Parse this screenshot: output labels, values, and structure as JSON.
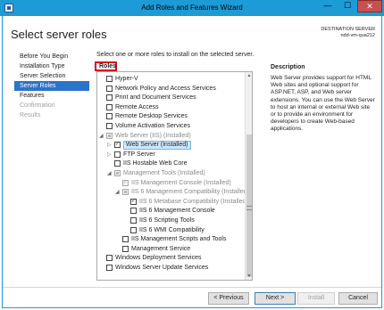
{
  "window": {
    "title": "Add Roles and Features Wizard",
    "min_glyph": "—",
    "max_glyph": "☐",
    "close_glyph": "✕"
  },
  "header": {
    "title": "Select server roles",
    "destination_caption": "DESTINATION SERVER",
    "destination_server": "ndd-vm-qua212"
  },
  "nav": [
    {
      "label": "Before You Begin",
      "state": "normal"
    },
    {
      "label": "Installation Type",
      "state": "normal"
    },
    {
      "label": "Server Selection",
      "state": "normal"
    },
    {
      "label": "Server Roles",
      "state": "active"
    },
    {
      "label": "Features",
      "state": "normal"
    },
    {
      "label": "Confirmation",
      "state": "disabled"
    },
    {
      "label": "Results",
      "state": "disabled"
    }
  ],
  "main": {
    "instruction": "Select one or more roles to install on the selected server.",
    "roles_header": "Roles",
    "roles": [
      {
        "label": "Hyper-V",
        "level": 0,
        "checkbox": "empty",
        "expander": ""
      },
      {
        "label": "Network Policy and Access Services",
        "level": 0,
        "checkbox": "empty",
        "expander": ""
      },
      {
        "label": "Print and Document Services",
        "level": 0,
        "checkbox": "empty",
        "expander": ""
      },
      {
        "label": "Remote Access",
        "level": 0,
        "checkbox": "empty",
        "expander": ""
      },
      {
        "label": "Remote Desktop Services",
        "level": 0,
        "checkbox": "empty",
        "expander": ""
      },
      {
        "label": "Volume Activation Services",
        "level": 0,
        "checkbox": "empty",
        "expander": ""
      },
      {
        "label": "Web Server (IIS) (Installed)",
        "level": 0,
        "checkbox": "partial-dim",
        "expander": "open",
        "dim": true
      },
      {
        "label": "Web Server (Installed)",
        "level": 1,
        "checkbox": "checked",
        "expander": "closed",
        "selected": true
      },
      {
        "label": "FTP Server",
        "level": 1,
        "checkbox": "empty",
        "expander": "closed"
      },
      {
        "label": "IIS Hostable Web Core",
        "level": 1,
        "checkbox": "empty",
        "expander": ""
      },
      {
        "label": "Management Tools (Installed)",
        "level": 1,
        "checkbox": "partial-dim",
        "expander": "open",
        "dim": true
      },
      {
        "label": "IIS Management Console (Installed)",
        "level": 2,
        "checkbox": "checked-dim",
        "expander": "",
        "dim": true
      },
      {
        "label": "IIS 6 Management Compatibility (Installed)",
        "level": 2,
        "checkbox": "partial-dim",
        "expander": "open",
        "dim": true
      },
      {
        "label": "IIS 6 Metabase Compatibility (Installed)",
        "level": 3,
        "checkbox": "checked",
        "expander": "",
        "dim": true
      },
      {
        "label": "IIS 6 Management Console",
        "level": 3,
        "checkbox": "empty",
        "expander": ""
      },
      {
        "label": "IIS 6 Scripting Tools",
        "level": 3,
        "checkbox": "empty",
        "expander": ""
      },
      {
        "label": "IIS 6 WMI Compatibility",
        "level": 3,
        "checkbox": "empty",
        "expander": ""
      },
      {
        "label": "IIS Management Scripts and Tools",
        "level": 2,
        "checkbox": "empty",
        "expander": ""
      },
      {
        "label": "Management Service",
        "level": 2,
        "checkbox": "empty",
        "expander": ""
      },
      {
        "label": "Windows Deployment Services",
        "level": 0,
        "checkbox": "empty",
        "expander": ""
      },
      {
        "label": "Windows Server Update Services",
        "level": 0,
        "checkbox": "empty",
        "expander": ""
      }
    ]
  },
  "description": {
    "header": "Description",
    "text": "Web Server provides support for HTML Web sites and optional support for ASP.NET, ASP, and Web server extensions. You can use the Web Server to host an internal or external Web site or to provide an environment for developers to create Web-based applications."
  },
  "footer": {
    "previous": "< Previous",
    "next": "Next >",
    "install": "Install",
    "cancel": "Cancel"
  },
  "colors": {
    "titlebar": "#1d9bd6",
    "nav_active": "#2a74c9",
    "roles_highlight": "#e0001b",
    "selection": "#cce8ff"
  }
}
